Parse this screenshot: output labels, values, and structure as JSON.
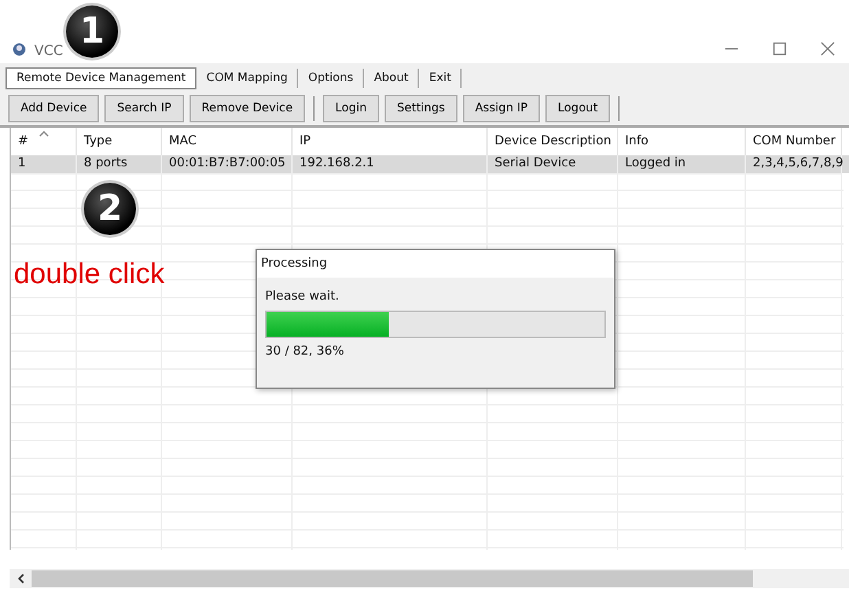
{
  "window": {
    "title": "VCC"
  },
  "tabs": [
    {
      "label": "Remote Device Management",
      "selected": true
    },
    {
      "label": "COM Mapping",
      "selected": false
    },
    {
      "label": "Options",
      "selected": false
    },
    {
      "label": "About",
      "selected": false
    },
    {
      "label": "Exit",
      "selected": false
    }
  ],
  "toolbar": [
    [
      "Add Device",
      "Search IP",
      "Remove Device"
    ],
    [
      "Login",
      "Settings",
      "Assign IP",
      "Logout"
    ]
  ],
  "table": {
    "columns": [
      "#",
      "Type",
      "MAC",
      "IP",
      "Device Description",
      "Info",
      "COM Number"
    ],
    "rows": [
      {
        "selected": true,
        "cells": [
          "1",
          "8 ports",
          "00:01:B7:B7:00:05",
          "192.168.2.1",
          "Serial Device",
          "Logged in",
          "2,3,4,5,6,7,8,9"
        ]
      }
    ]
  },
  "annotations": {
    "step_1": "1",
    "step_2": "2",
    "note": "double click"
  },
  "dialog": {
    "title": "Processing",
    "message": "Please wait.",
    "level": 0.36,
    "reading": "30 / 82, 36%"
  }
}
